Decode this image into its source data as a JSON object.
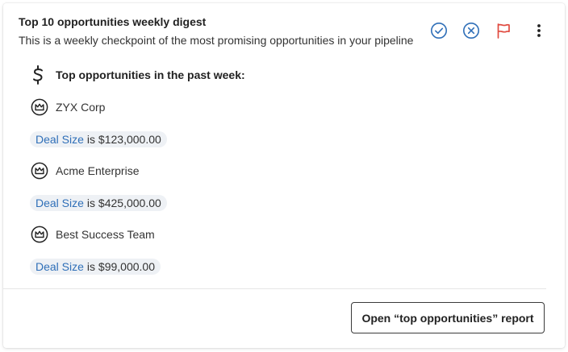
{
  "card": {
    "title": "Top 10 opportunities weekly digest",
    "subtitle": "This is a weekly checkpoint of the most promising opportunities in your pipeline"
  },
  "actions": {
    "icons": [
      "check-circle-icon",
      "close-circle-icon",
      "flag-icon",
      "more-vertical-icon"
    ],
    "colors": {
      "primary": "#2f6fb8",
      "flag": "#e04a3f"
    }
  },
  "section": {
    "icon": "dollar-icon",
    "heading": "Top opportunities in the past week:"
  },
  "opportunities": [
    {
      "icon": "crown-icon",
      "name": "ZYX Corp",
      "deal_field": "Deal Size",
      "deal_text": "is $123,000.00"
    },
    {
      "icon": "crown-icon",
      "name": "Acme Enterprise",
      "deal_field": "Deal Size",
      "deal_text": "is $425,000.00"
    },
    {
      "icon": "crown-icon",
      "name": "Best Success Team",
      "deal_field": "Deal Size",
      "deal_text": "is $99,000.00"
    }
  ],
  "footer": {
    "report_button_label": "Open “top opportunities” report"
  }
}
